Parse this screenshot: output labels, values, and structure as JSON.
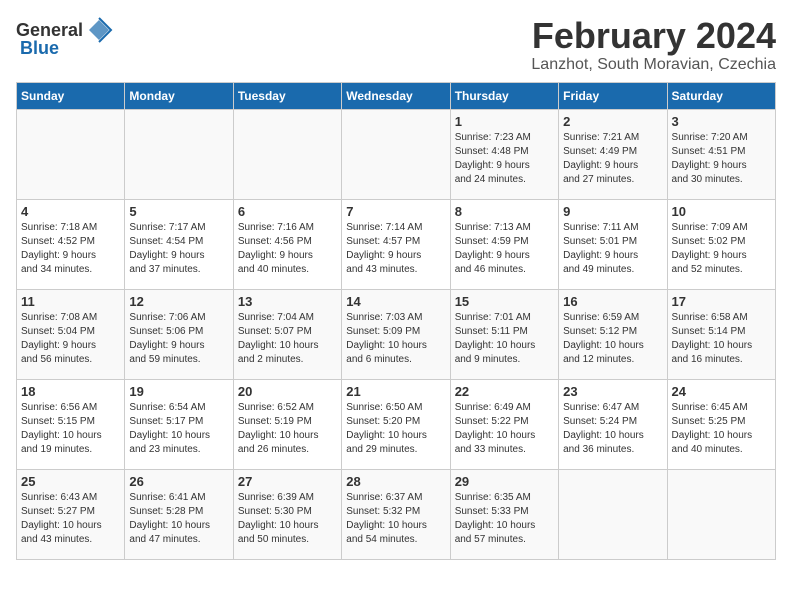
{
  "header": {
    "logo_general": "General",
    "logo_blue": "Blue",
    "title": "February 2024",
    "subtitle": "Lanzhot, South Moravian, Czechia"
  },
  "days_of_week": [
    "Sunday",
    "Monday",
    "Tuesday",
    "Wednesday",
    "Thursday",
    "Friday",
    "Saturday"
  ],
  "weeks": [
    [
      {
        "num": "",
        "info": ""
      },
      {
        "num": "",
        "info": ""
      },
      {
        "num": "",
        "info": ""
      },
      {
        "num": "",
        "info": ""
      },
      {
        "num": "1",
        "info": "Sunrise: 7:23 AM\nSunset: 4:48 PM\nDaylight: 9 hours\nand 24 minutes."
      },
      {
        "num": "2",
        "info": "Sunrise: 7:21 AM\nSunset: 4:49 PM\nDaylight: 9 hours\nand 27 minutes."
      },
      {
        "num": "3",
        "info": "Sunrise: 7:20 AM\nSunset: 4:51 PM\nDaylight: 9 hours\nand 30 minutes."
      }
    ],
    [
      {
        "num": "4",
        "info": "Sunrise: 7:18 AM\nSunset: 4:52 PM\nDaylight: 9 hours\nand 34 minutes."
      },
      {
        "num": "5",
        "info": "Sunrise: 7:17 AM\nSunset: 4:54 PM\nDaylight: 9 hours\nand 37 minutes."
      },
      {
        "num": "6",
        "info": "Sunrise: 7:16 AM\nSunset: 4:56 PM\nDaylight: 9 hours\nand 40 minutes."
      },
      {
        "num": "7",
        "info": "Sunrise: 7:14 AM\nSunset: 4:57 PM\nDaylight: 9 hours\nand 43 minutes."
      },
      {
        "num": "8",
        "info": "Sunrise: 7:13 AM\nSunset: 4:59 PM\nDaylight: 9 hours\nand 46 minutes."
      },
      {
        "num": "9",
        "info": "Sunrise: 7:11 AM\nSunset: 5:01 PM\nDaylight: 9 hours\nand 49 minutes."
      },
      {
        "num": "10",
        "info": "Sunrise: 7:09 AM\nSunset: 5:02 PM\nDaylight: 9 hours\nand 52 minutes."
      }
    ],
    [
      {
        "num": "11",
        "info": "Sunrise: 7:08 AM\nSunset: 5:04 PM\nDaylight: 9 hours\nand 56 minutes."
      },
      {
        "num": "12",
        "info": "Sunrise: 7:06 AM\nSunset: 5:06 PM\nDaylight: 9 hours\nand 59 minutes."
      },
      {
        "num": "13",
        "info": "Sunrise: 7:04 AM\nSunset: 5:07 PM\nDaylight: 10 hours\nand 2 minutes."
      },
      {
        "num": "14",
        "info": "Sunrise: 7:03 AM\nSunset: 5:09 PM\nDaylight: 10 hours\nand 6 minutes."
      },
      {
        "num": "15",
        "info": "Sunrise: 7:01 AM\nSunset: 5:11 PM\nDaylight: 10 hours\nand 9 minutes."
      },
      {
        "num": "16",
        "info": "Sunrise: 6:59 AM\nSunset: 5:12 PM\nDaylight: 10 hours\nand 12 minutes."
      },
      {
        "num": "17",
        "info": "Sunrise: 6:58 AM\nSunset: 5:14 PM\nDaylight: 10 hours\nand 16 minutes."
      }
    ],
    [
      {
        "num": "18",
        "info": "Sunrise: 6:56 AM\nSunset: 5:15 PM\nDaylight: 10 hours\nand 19 minutes."
      },
      {
        "num": "19",
        "info": "Sunrise: 6:54 AM\nSunset: 5:17 PM\nDaylight: 10 hours\nand 23 minutes."
      },
      {
        "num": "20",
        "info": "Sunrise: 6:52 AM\nSunset: 5:19 PM\nDaylight: 10 hours\nand 26 minutes."
      },
      {
        "num": "21",
        "info": "Sunrise: 6:50 AM\nSunset: 5:20 PM\nDaylight: 10 hours\nand 29 minutes."
      },
      {
        "num": "22",
        "info": "Sunrise: 6:49 AM\nSunset: 5:22 PM\nDaylight: 10 hours\nand 33 minutes."
      },
      {
        "num": "23",
        "info": "Sunrise: 6:47 AM\nSunset: 5:24 PM\nDaylight: 10 hours\nand 36 minutes."
      },
      {
        "num": "24",
        "info": "Sunrise: 6:45 AM\nSunset: 5:25 PM\nDaylight: 10 hours\nand 40 minutes."
      }
    ],
    [
      {
        "num": "25",
        "info": "Sunrise: 6:43 AM\nSunset: 5:27 PM\nDaylight: 10 hours\nand 43 minutes."
      },
      {
        "num": "26",
        "info": "Sunrise: 6:41 AM\nSunset: 5:28 PM\nDaylight: 10 hours\nand 47 minutes."
      },
      {
        "num": "27",
        "info": "Sunrise: 6:39 AM\nSunset: 5:30 PM\nDaylight: 10 hours\nand 50 minutes."
      },
      {
        "num": "28",
        "info": "Sunrise: 6:37 AM\nSunset: 5:32 PM\nDaylight: 10 hours\nand 54 minutes."
      },
      {
        "num": "29",
        "info": "Sunrise: 6:35 AM\nSunset: 5:33 PM\nDaylight: 10 hours\nand 57 minutes."
      },
      {
        "num": "",
        "info": ""
      },
      {
        "num": "",
        "info": ""
      }
    ]
  ]
}
